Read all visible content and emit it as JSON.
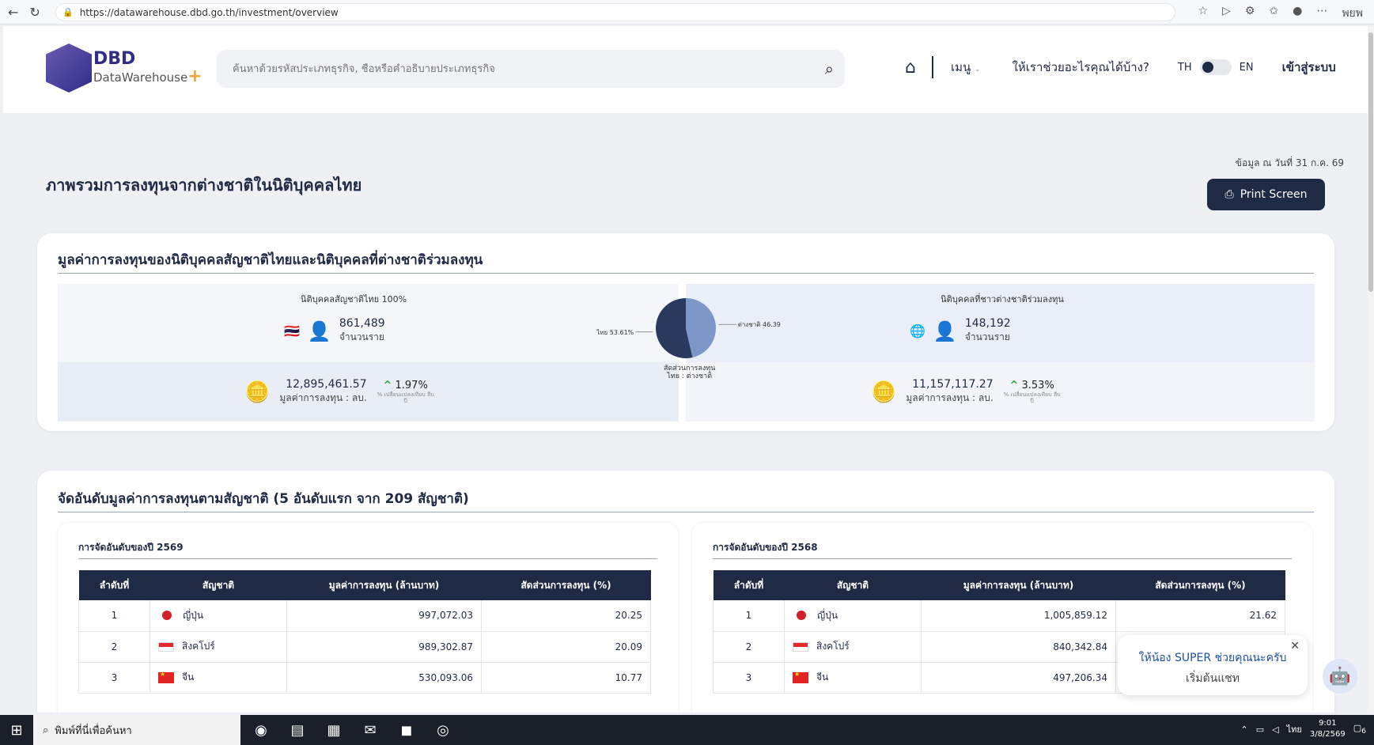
{
  "browser": {
    "url": "https://datawarehouse.dbd.go.th/investment/overview",
    "profile_label": "พยพ"
  },
  "header": {
    "logo_text": "DataWarehouse",
    "logo_abbr": "DBD",
    "logo_plus": "+",
    "search_placeholder": "ค้นหาด้วยรหัสประเภทธุรกิจ, ชื่อหรือคำอธิบายประเภทธุรกิจ",
    "menu_label": "เมนู",
    "help_label": "ให้เราช่วยอะไรคุณได้บ้าง?",
    "lang_th": "TH",
    "lang_en": "EN",
    "login_label": "เข้าสู่ระบบ"
  },
  "page": {
    "title": "ภาพรวมการลงทุนจากต่างชาติในนิติบุคคลไทย",
    "date_note": "ข้อมูล ณ วันที่ 31 ก.ค. 69",
    "print_label": "Print Screen"
  },
  "investment_value": {
    "heading": "มูลค่าการลงทุนของนิติบุคคลสัญชาติไทยและนิติบุคคลที่ต่างชาติร่วมลงทุน",
    "thai": {
      "title": "นิติบุคคลสัญชาติไทย 100%",
      "count": "861,489",
      "count_label": "จำนวนราย",
      "value": "12,895,461.57",
      "value_label": "มูลค่าการลงทุน : ลบ.",
      "change": "1.97%",
      "change_note": "% เปลี่ยนแปลงเทียบ ลีบปี"
    },
    "foreign": {
      "title": "นิติบุคคลที่ชาวต่างชาติร่วมลงทุน",
      "count": "148,192",
      "count_label": "จำนวนราย",
      "value": "11,157,117.27",
      "value_label": "มูลค่าการลงทุน : ลบ.",
      "change": "3.53%",
      "change_note": "% เปลี่ยนแปลงเทียบ ลีบปี"
    },
    "pie_caption_1": "สัดส่วนการลงทุน",
    "pie_caption_2": "ไทย : ต่างชาติ"
  },
  "chart_data": {
    "type": "pie",
    "categories": [
      "ไทย",
      "ต่างชาติ"
    ],
    "values": [
      53.61,
      46.39
    ],
    "labels": [
      "ไทย 53.61%",
      "ต่างชาติ 46.39%"
    ],
    "colors": [
      "#2a3a5e",
      "#7d97c9"
    ]
  },
  "ranking": {
    "heading": "จัดอันดับมูลค่าการลงทุนตามสัญชาติ (5 อันดับแรก จาก 209 สัญชาติ)",
    "columns": [
      "ลำดับที่",
      "สัญชาติ",
      "มูลค่าการลงทุน (ล้านบาท)",
      "สัดส่วนการลงทุน (%)"
    ],
    "year_2569": {
      "title": "การจัดอันดับของปี 2569",
      "rows": [
        {
          "rank": "1",
          "flag": "jp",
          "nation": "ญี่ปุ่น",
          "value": "997,072.03",
          "share": "20.25"
        },
        {
          "rank": "2",
          "flag": "sg",
          "nation": "สิงคโปร์",
          "value": "989,302.87",
          "share": "20.09"
        },
        {
          "rank": "3",
          "flag": "cn",
          "nation": "จีน",
          "value": "530,093.06",
          "share": "10.77"
        }
      ]
    },
    "year_2568": {
      "title": "การจัดอันดับของปี 2568",
      "rows": [
        {
          "rank": "1",
          "flag": "jp",
          "nation": "ญี่ปุ่น",
          "value": "1,005,859.12",
          "share": "21.62"
        },
        {
          "rank": "2",
          "flag": "sg",
          "nation": "สิงคโปร์",
          "value": "840,342.84",
          "share": ""
        },
        {
          "rank": "3",
          "flag": "cn",
          "nation": "จีน",
          "value": "497,206.34",
          "share": ""
        }
      ]
    }
  },
  "chat": {
    "line1": "ให้น้อง SUPER ช่วยคุณนะครับ",
    "line2": "เริ่มต้นแชท"
  },
  "taskbar": {
    "search_placeholder": "พิมพ์ที่นี่เพื่อค้นหา",
    "lang": "ไทย",
    "time": "9:01",
    "date": "3/8/2569",
    "notification_count": "6"
  }
}
